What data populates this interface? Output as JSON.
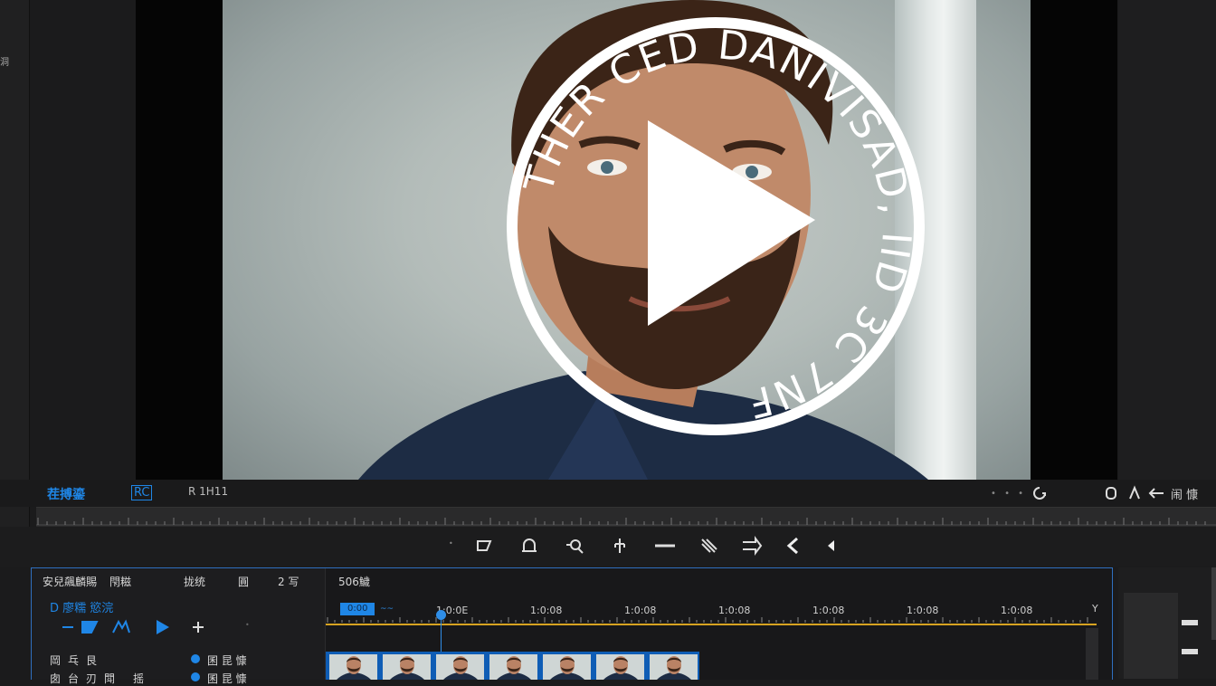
{
  "left_panel": {
    "glyph": "洞"
  },
  "viewer": {
    "overlay_text_lines": [
      "THER CED",
      "DANIVISAD",
      "IID",
      "3C 7NF"
    ],
    "overlay_text": "THER CED DANIVISAD, IID 3C 7NF"
  },
  "viewer_bar": {
    "project_label": "茬搏鎏",
    "badge": "RC",
    "badge_prefix": "",
    "time_label": "R 1H11",
    "right_labels": [
      "闹 慷"
    ]
  },
  "timeline": {
    "header_row": [
      "安兒飆麟賜",
      "閇糍",
      "拢统",
      "圓",
      "2 写"
    ],
    "sequence_title": "D 廖糯 慾浣",
    "track_rows": [
      [
        "岡",
        "乓",
        "艮"
      ],
      [
        "囱",
        "台",
        "刃",
        "閗",
        "摇"
      ]
    ],
    "track_labels": [
      "囷 昆 慷",
      "囷 昆 慷"
    ],
    "duration": "506鱥",
    "in_marker": "0:00",
    "timecodes": [
      "1:0:0E",
      "1:0:08",
      "1:0:08",
      "1:0:08",
      "1:0:08",
      "1:0:08",
      "1:0:08",
      "1:0:08"
    ],
    "clip_count": 7
  },
  "colors": {
    "accent": "#1f86e6",
    "playhead": "#2f8ee8",
    "timeline_border": "#2f6fbf",
    "ruler_line": "#d7a321",
    "clip": "#0f5db5"
  }
}
